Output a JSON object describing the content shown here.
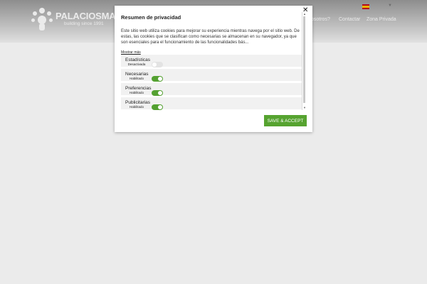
{
  "header": {
    "logo_name": "PALACIOSMAR",
    "logo_tagline": "building since 1991",
    "nav_items": [
      "osotros?",
      "Contactar",
      "Zona Privada"
    ]
  },
  "modal": {
    "title": "Resumen de privacidad",
    "description": "Este sitio web utiliza cookies para mejorar su experiencia mientras navega por el sitio web. De estas, las cookies que se clasifican como necesarias se almacenan en su navegador, ya que son esenciales para el funcionamiento de las funcionalidades bás...",
    "show_more": "Mostrar más",
    "categories": [
      {
        "name": "Estadísticas",
        "state": "Desactivada",
        "enabled": false
      },
      {
        "name": "Necesarias",
        "state": "Habilitado",
        "enabled": true
      },
      {
        "name": "Preferencias",
        "state": "Habilitado",
        "enabled": true
      },
      {
        "name": "Publicitarias",
        "state": "Habilitado",
        "enabled": true
      }
    ],
    "close_icon": "close-icon",
    "save_label": "SAVE & ACCEPT"
  },
  "colors": {
    "accent_green": "#56a330",
    "toggle_off": "#e3e3e3"
  }
}
